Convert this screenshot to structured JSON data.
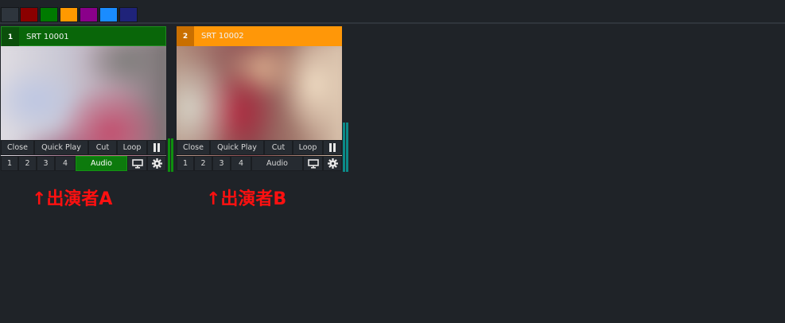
{
  "palette": {
    "swatches": [
      "#2e353d",
      "#8b0000",
      "#007a00",
      "#ff9900",
      "#8a008a",
      "#1a8cff",
      "#1f237a"
    ]
  },
  "panels": [
    {
      "number": "1",
      "name": "SRT 10001",
      "header_color": "#096609",
      "number_bg": "#0b4f0b",
      "buttons": {
        "close": "Close",
        "quick_play": "Quick Play",
        "cut": "Cut",
        "loop": "Loop",
        "audio": "Audio"
      },
      "channels": [
        "1",
        "2",
        "3",
        "4"
      ],
      "audio_active": true,
      "meter_color": "#0f8f0f",
      "icons": [
        "pause-icon",
        "monitor-icon",
        "gear-icon"
      ]
    },
    {
      "number": "2",
      "name": "SRT 10002",
      "header_color": "#ff9708",
      "number_bg": "#c96f00",
      "buttons": {
        "close": "Close",
        "quick_play": "Quick Play",
        "cut": "Cut",
        "loop": "Loop",
        "audio": "Audio"
      },
      "channels": [
        "1",
        "2",
        "3",
        "4"
      ],
      "audio_active": false,
      "meter_color": "#0b8a88",
      "icons": [
        "pause-icon",
        "monitor-icon",
        "gear-icon"
      ]
    }
  ],
  "annotations": [
    "↑出演者A",
    "↑出演者B"
  ],
  "annotation_color": "#ff1010"
}
